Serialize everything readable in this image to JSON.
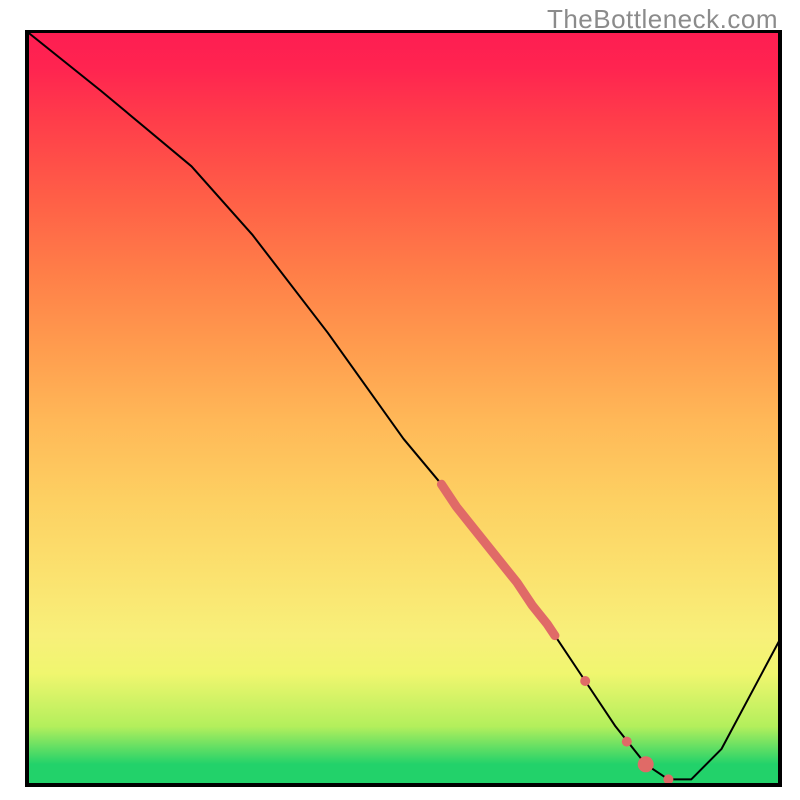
{
  "watermark": "TheBottleneck.com",
  "chart_data": {
    "type": "line",
    "title": "",
    "xlabel": "",
    "ylabel": "",
    "xlim": [
      0,
      100
    ],
    "ylim": [
      0,
      100
    ],
    "grid": false,
    "legend": false,
    "background_gradient": {
      "bottom_color": "#22d26a",
      "top_color": "#fe1d52",
      "meaning": "green=good, red=bad"
    },
    "series": [
      {
        "name": "bottleneck-curve",
        "x": [
          0,
          10,
          22,
          30,
          40,
          50,
          55,
          60,
          65,
          70,
          74,
          78,
          82,
          85,
          88,
          92,
          100
        ],
        "y": [
          100,
          92,
          82,
          73,
          60,
          46,
          40,
          33,
          27,
          20,
          14,
          8,
          3,
          1,
          1,
          5,
          20
        ],
        "color": "#000000",
        "stroke_width": 2
      },
      {
        "name": "highlight-segment",
        "x": [
          55,
          57,
          59,
          61,
          63,
          65,
          67,
          69,
          70
        ],
        "y": [
          40,
          37,
          34.5,
          32,
          29.5,
          27,
          24,
          21.5,
          20
        ],
        "color": "#e06a67",
        "stroke_width": 9
      }
    ],
    "highlight_points": [
      {
        "x": 74,
        "y": 14,
        "r": 5,
        "color": "#e06a67"
      },
      {
        "x": 79.5,
        "y": 6,
        "r": 5,
        "color": "#e06a67"
      },
      {
        "x": 82,
        "y": 3,
        "r": 8,
        "color": "#e06a67"
      },
      {
        "x": 85,
        "y": 1,
        "r": 5,
        "color": "#e06a67"
      }
    ]
  }
}
